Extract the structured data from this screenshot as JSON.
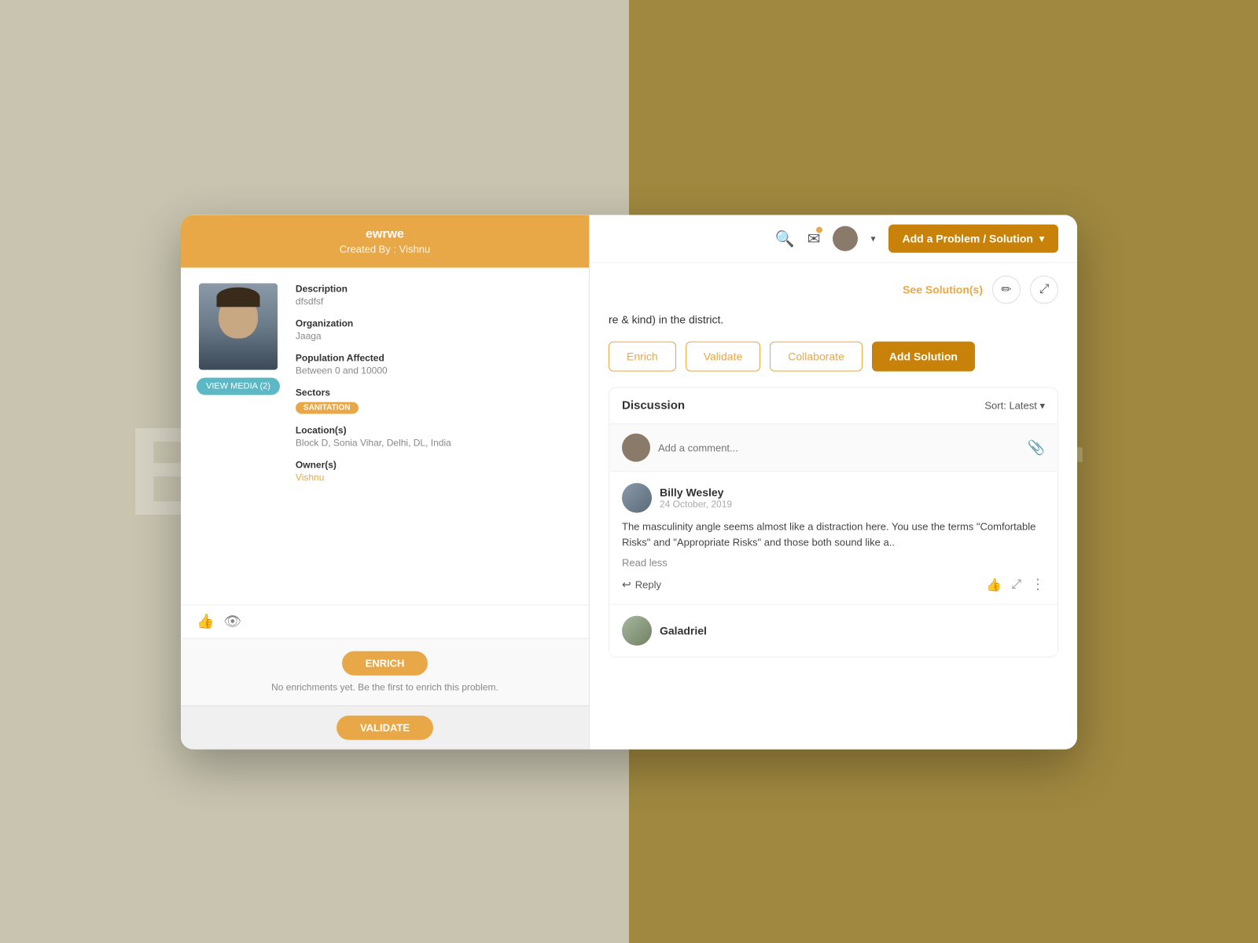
{
  "background": {
    "left_text": "Before",
    "right_text": "After"
  },
  "navbar": {
    "add_problem_label": "Add a Problem / Solution",
    "chevron": "▾"
  },
  "problem_card": {
    "title": "ewrwe",
    "created_by": "Created By : Vishnu",
    "description_label": "Description",
    "description_value": "dfsdfsf",
    "organization_label": "Organization",
    "organization_value": "Jaaga",
    "population_label": "Population Affected",
    "population_value": "Between 0 and 10000",
    "sectors_label": "Sectors",
    "sector_badge": "SANITATION",
    "locations_label": "Location(s)",
    "location_value": "Block D, Sonia Vihar, Delhi, DL, India",
    "owners_label": "Owner(s)",
    "owner_value": "Vishnu",
    "view_media_btn": "VIEW MEDIA (2)",
    "enrich_btn": "ENRICH",
    "enrich_note": "No enrichments yet. Be the first to enrich this problem.",
    "validate_btn": "VALIDATE"
  },
  "content": {
    "see_solutions": "See Solution(s)",
    "problem_description": "re & kind) in the district.",
    "enrich_btn": "Enrich",
    "validate_btn": "Validate",
    "collaborate_btn": "Collaborate",
    "add_solution_btn": "Add Solution"
  },
  "discussion": {
    "title": "Discussion",
    "sort_label": "Sort: Latest",
    "comment_placeholder": "Add a comment...",
    "comments": [
      {
        "name": "Billy Wesley",
        "date": "24 October, 2019",
        "text": "The masculinity angle seems almost like a distraction here.\nYou use the terms \"Comfortable Risks\" and \"Appropriate Risks\" and those both sound like a..",
        "read_less": "Read less",
        "reply_label": "Reply"
      },
      {
        "name": "Galadriel",
        "date": "",
        "text": ""
      }
    ]
  }
}
